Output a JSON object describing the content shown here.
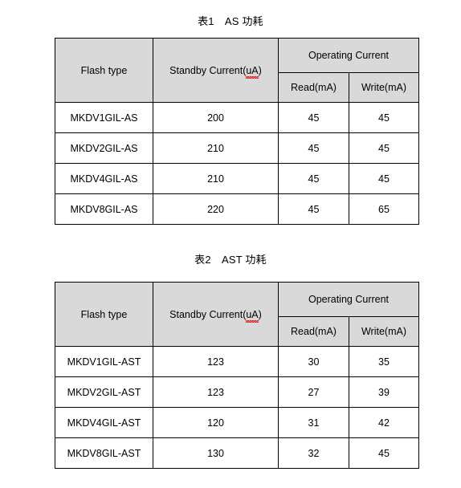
{
  "document": {
    "tables": [
      {
        "id": "table-1",
        "caption": "表1　AS 功耗",
        "headers": {
          "flash_type": "Flash type",
          "standby_current_main": "Standby Current(",
          "standby_current_spell": "uA",
          "standby_current_tail": ")",
          "standby_current_full": "Standby Current(uA)",
          "operating_current": "Operating Current",
          "read": "Read(mA)",
          "write": "Write(mA)"
        },
        "rows": [
          {
            "flash_type": "MKDV1GIL-AS",
            "standby_current": "200",
            "read": "45",
            "write": "45"
          },
          {
            "flash_type": "MKDV2GIL-AS",
            "standby_current": "210",
            "read": "45",
            "write": "45"
          },
          {
            "flash_type": "MKDV4GIL-AS",
            "standby_current": "210",
            "read": "45",
            "write": "45"
          },
          {
            "flash_type": "MKDV8GIL-AS",
            "standby_current": "220",
            "read": "45",
            "write": "65"
          }
        ]
      },
      {
        "id": "table-2",
        "caption": "表2　AST 功耗",
        "headers": {
          "flash_type": "Flash type",
          "standby_current_main": "Standby Current(",
          "standby_current_spell": "uA",
          "standby_current_tail": ")",
          "standby_current_full": "Standby Current(uA)",
          "operating_current": "Operating Current",
          "read": "Read(mA)",
          "write": "Write(mA)"
        },
        "rows": [
          {
            "flash_type": "MKDV1GIL-AST",
            "standby_current": "123",
            "read": "30",
            "write": "35"
          },
          {
            "flash_type": "MKDV2GIL-AST",
            "standby_current": "123",
            "read": "27",
            "write": "39"
          },
          {
            "flash_type": "MKDV4GIL-AST",
            "standby_current": "120",
            "read": "31",
            "write": "42"
          },
          {
            "flash_type": "MKDV8GIL-AST",
            "standby_current": "130",
            "read": "32",
            "write": "45"
          }
        ]
      }
    ],
    "colors": {
      "header_fill": "#d9d9d9",
      "border": "#000000",
      "page_background": "#ffffff",
      "spellcheck_underline": "#e02020"
    }
  }
}
